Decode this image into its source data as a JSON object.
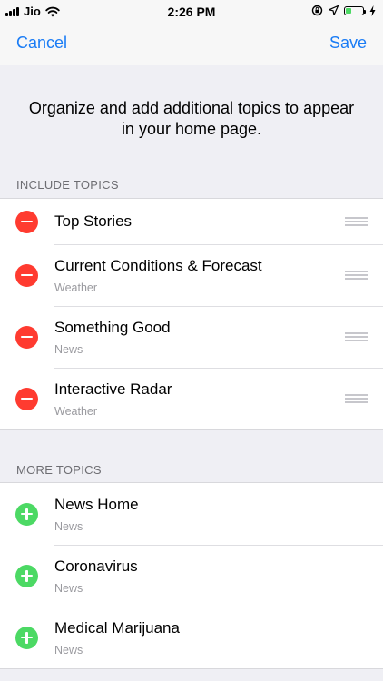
{
  "status_bar": {
    "carrier": "Jio",
    "time": "2:26 PM",
    "icons": [
      "signal-icon",
      "wifi-icon",
      "orientation-lock-icon",
      "location-arrow-icon",
      "battery-icon",
      "charging-icon"
    ],
    "battery_level": 0.35
  },
  "nav": {
    "cancel_label": "Cancel",
    "save_label": "Save",
    "accent_color": "#1a7cf5"
  },
  "intro_text": "Organize and add additional topics to appear in your home page.",
  "include_section": {
    "header": "INCLUDE TOPICS",
    "items": [
      {
        "title": "Top Stories",
        "subtitle": ""
      },
      {
        "title": "Current Conditions & Forecast",
        "subtitle": "Weather"
      },
      {
        "title": "Something Good",
        "subtitle": "News"
      },
      {
        "title": "Interactive Radar",
        "subtitle": "Weather"
      }
    ]
  },
  "more_section": {
    "header": "MORE TOPICS",
    "items": [
      {
        "title": "News Home",
        "subtitle": "News"
      },
      {
        "title": "Coronavirus",
        "subtitle": "News"
      },
      {
        "title": "Medical Marijuana",
        "subtitle": "News"
      }
    ]
  },
  "colors": {
    "remove": "#ff3b30",
    "add": "#4cd964",
    "battery": "#4cd964"
  }
}
